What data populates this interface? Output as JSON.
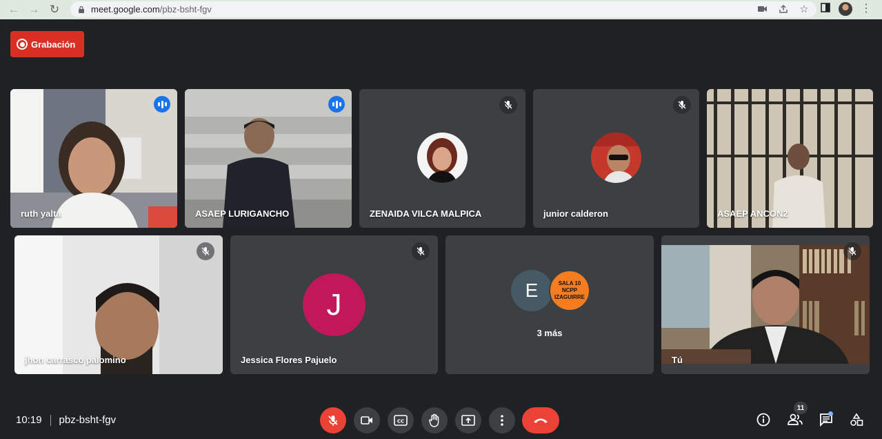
{
  "browser": {
    "url_host": "meet.google.com",
    "url_path": "/pbz-bsht-fgv"
  },
  "recording": {
    "label": "Grabación",
    "color": "#d93025"
  },
  "tiles": [
    {
      "name": "ruth yalta",
      "status": "speaking",
      "mic": "on"
    },
    {
      "name": "ASAEP LURIGANCHO",
      "status": "speaking",
      "mic": "on"
    },
    {
      "name": "ZENAIDA VILCA MALPICA",
      "mic": "muted"
    },
    {
      "name": "junior calderon",
      "mic": "muted"
    },
    {
      "name": "ASAEP ANCON2",
      "mic": "muted"
    },
    {
      "name": "jhon carrasco palomino",
      "mic": "muted"
    },
    {
      "name": "Jessica Flores Pajuelo",
      "mic": "muted",
      "avatar_letter": "J",
      "avatar_color": "#c2185b"
    },
    {
      "more_label": "3 más",
      "avatar_letter": "E",
      "avatar_color": "#455a64",
      "second_avatar_lines": [
        "SALA 10",
        "NCPP",
        "IZAGUIRRE"
      ],
      "second_avatar_color": "#f57c1f"
    },
    {
      "name": "Tú",
      "mic": "muted"
    }
  ],
  "meeting": {
    "time": "10:19",
    "code": "pbz-bsht-fgv"
  },
  "controls": [
    "mic-off-icon",
    "camera-icon",
    "captions-icon",
    "raise-hand-icon",
    "present-icon",
    "more-options-icon",
    "end-call-icon"
  ],
  "right_controls": {
    "participants_count": "11"
  },
  "colors": {
    "accent": "#8ab4f8",
    "danger": "#ea4335",
    "background": "#202124",
    "tile": "#3c4043"
  }
}
